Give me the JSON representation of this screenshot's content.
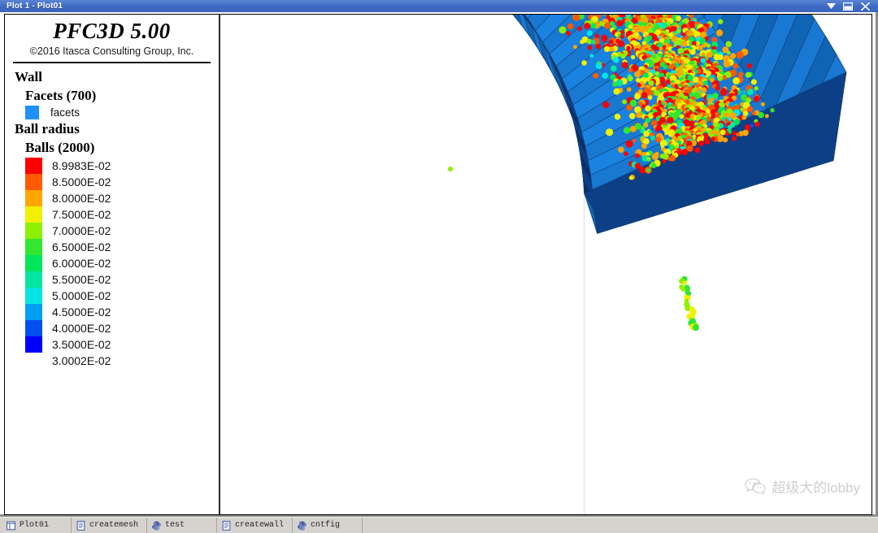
{
  "window": {
    "title": "Plot 1 - Plot01",
    "controls": [
      {
        "name": "minimize-button",
        "icon": "chevron-down-icon"
      },
      {
        "name": "restore-button",
        "icon": "restore-icon"
      },
      {
        "name": "close-button",
        "icon": "close-icon"
      }
    ]
  },
  "brand": {
    "title": "PFC3D 5.00",
    "copyright": "©2016 Itasca Consulting Group, Inc."
  },
  "legend": {
    "wall_heading": "Wall",
    "facets_heading": "Facets (700)",
    "facets_label": "facets",
    "facets_color": "#1e90ff",
    "ball_radius_heading": "Ball radius",
    "balls_heading": "Balls (2000)",
    "scale": [
      {
        "value": "8.9983E-02",
        "color": "#ff0000"
      },
      {
        "value": "8.5000E-02",
        "color": "#ff5a00"
      },
      {
        "value": "8.0000E-02",
        "color": "#ffa500"
      },
      {
        "value": "7.5000E-02",
        "color": "#f0f000"
      },
      {
        "value": "7.0000E-02",
        "color": "#8cf000"
      },
      {
        "value": "6.5000E-02",
        "color": "#32e632"
      },
      {
        "value": "6.0000E-02",
        "color": "#00e65a"
      },
      {
        "value": "5.5000E-02",
        "color": "#00e6a0"
      },
      {
        "value": "5.0000E-02",
        "color": "#00e6e6"
      },
      {
        "value": "4.5000E-02",
        "color": "#00a0f0"
      },
      {
        "value": "4.0000E-02",
        "color": "#0050f0"
      },
      {
        "value": "3.5000E-02",
        "color": "#0000ff"
      },
      {
        "value": "3.0002E-02",
        "color": null
      }
    ]
  },
  "viewport": {
    "name": "3d-plot-viewport",
    "wall_color_light": "#1878d2",
    "wall_color_mid": "#1064b4",
    "wall_color_dark": "#0d3f86",
    "wall_color_darker": "#0a2f6b",
    "background": "#ffffff"
  },
  "watermark": {
    "text": "超级大的lobby"
  },
  "taskbar": {
    "items": [
      {
        "label": "Plot01",
        "icon": "plot-window-icon"
      },
      {
        "label": "createmesh",
        "icon": "document-icon"
      },
      {
        "label": "test",
        "icon": "python-icon"
      },
      {
        "label": "createwall",
        "icon": "document-icon"
      },
      {
        "label": "cntfig",
        "icon": "python-icon"
      }
    ]
  }
}
